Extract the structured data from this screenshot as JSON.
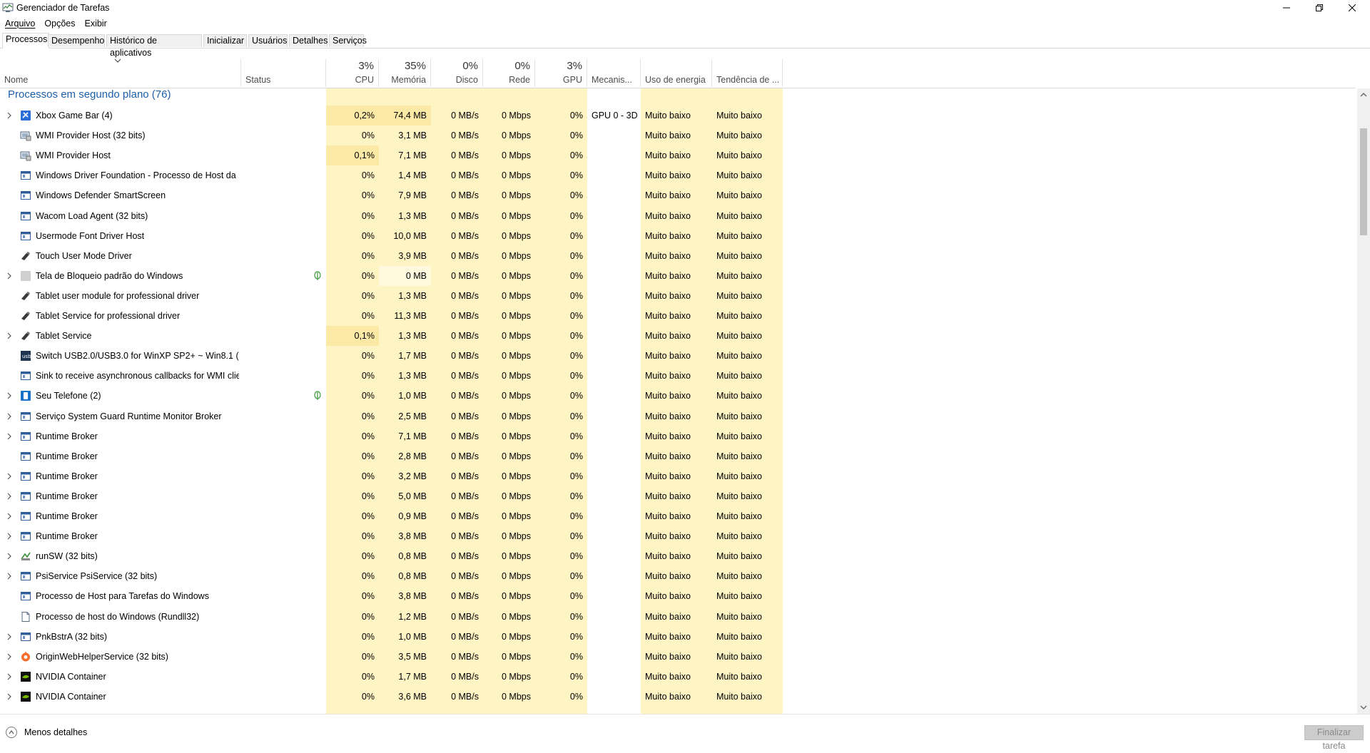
{
  "window": {
    "title": "Gerenciador de Tarefas"
  },
  "menu": {
    "items": [
      "Arquivo",
      "Opções",
      "Exibir"
    ]
  },
  "tabs": [
    {
      "label": "Processos",
      "active": true
    },
    {
      "label": "Desempenho",
      "active": false
    },
    {
      "label": "Histórico de aplicativos",
      "active": false
    },
    {
      "label": "Inicializar",
      "active": false
    },
    {
      "label": "Usuários",
      "active": false
    },
    {
      "label": "Detalhes",
      "active": false
    },
    {
      "label": "Serviços",
      "active": false
    }
  ],
  "columns": {
    "name": {
      "label": "Nome"
    },
    "status": {
      "label": "Status"
    },
    "cpu": {
      "label": "CPU",
      "pct": "3%"
    },
    "memory": {
      "label": "Memória",
      "pct": "35%"
    },
    "disk": {
      "label": "Disco",
      "pct": "0%"
    },
    "network": {
      "label": "Rede",
      "pct": "0%"
    },
    "gpu": {
      "label": "GPU",
      "pct": "3%"
    },
    "gpu_engine": {
      "label": "Mecanis..."
    },
    "power": {
      "label": "Uso de energia"
    },
    "power_trend": {
      "label": "Tendência de ..."
    }
  },
  "group": {
    "title": "Processos em segundo plano (76)"
  },
  "colors": {
    "heat_light": "#fff4c4",
    "heat_medium": "#fde9a6",
    "group_title": "#1e5fa8",
    "suspended_leaf": "#3c9a3c"
  },
  "processes": [
    {
      "name": "Xbox Game Bar (4)",
      "icon": "xbox-game-bar-icon",
      "expand": true,
      "leaf": false,
      "cpu": "0,2%",
      "mem": "74,4 MB",
      "disk": "0 MB/s",
      "net": "0 Mbps",
      "gpu": "0%",
      "engine": "GPU 0 - 3D",
      "power": "Muito baixo",
      "trend": "Muito baixo",
      "cpu_hot": true,
      "mem_hot": true
    },
    {
      "name": "WMI Provider Host (32 bits)",
      "icon": "wmi-host-icon",
      "expand": false,
      "leaf": false,
      "cpu": "0%",
      "mem": "3,1 MB",
      "disk": "0 MB/s",
      "net": "0 Mbps",
      "gpu": "0%",
      "engine": "",
      "power": "Muito baixo",
      "trend": "Muito baixo",
      "cpu_hot": false,
      "mem_hot": false
    },
    {
      "name": "WMI Provider Host",
      "icon": "wmi-host-icon",
      "expand": false,
      "leaf": false,
      "cpu": "0,1%",
      "mem": "7,1 MB",
      "disk": "0 MB/s",
      "net": "0 Mbps",
      "gpu": "0%",
      "engine": "",
      "power": "Muito baixo",
      "trend": "Muito baixo",
      "cpu_hot": true,
      "mem_hot": false
    },
    {
      "name": "Windows Driver Foundation - Processo de Host da ...",
      "icon": "window-app-icon",
      "expand": false,
      "leaf": false,
      "cpu": "0%",
      "mem": "1,4 MB",
      "disk": "0 MB/s",
      "net": "0 Mbps",
      "gpu": "0%",
      "engine": "",
      "power": "Muito baixo",
      "trend": "Muito baixo",
      "cpu_hot": false,
      "mem_hot": false
    },
    {
      "name": "Windows Defender SmartScreen",
      "icon": "window-app-icon",
      "expand": false,
      "leaf": false,
      "cpu": "0%",
      "mem": "7,9 MB",
      "disk": "0 MB/s",
      "net": "0 Mbps",
      "gpu": "0%",
      "engine": "",
      "power": "Muito baixo",
      "trend": "Muito baixo",
      "cpu_hot": false,
      "mem_hot": false
    },
    {
      "name": "Wacom Load Agent (32 bits)",
      "icon": "window-app-icon",
      "expand": false,
      "leaf": false,
      "cpu": "0%",
      "mem": "1,3 MB",
      "disk": "0 MB/s",
      "net": "0 Mbps",
      "gpu": "0%",
      "engine": "",
      "power": "Muito baixo",
      "trend": "Muito baixo",
      "cpu_hot": false,
      "mem_hot": false
    },
    {
      "name": "Usermode Font Driver Host",
      "icon": "window-app-icon",
      "expand": false,
      "leaf": false,
      "cpu": "0%",
      "mem": "10,0 MB",
      "disk": "0 MB/s",
      "net": "0 Mbps",
      "gpu": "0%",
      "engine": "",
      "power": "Muito baixo",
      "trend": "Muito baixo",
      "cpu_hot": false,
      "mem_hot": false
    },
    {
      "name": "Touch User Mode Driver",
      "icon": "pen-tablet-icon",
      "expand": false,
      "leaf": false,
      "cpu": "0%",
      "mem": "3,9 MB",
      "disk": "0 MB/s",
      "net": "0 Mbps",
      "gpu": "0%",
      "engine": "",
      "power": "Muito baixo",
      "trend": "Muito baixo",
      "cpu_hot": false,
      "mem_hot": false
    },
    {
      "name": "Tela de Bloqueio padrão do Windows",
      "icon": "lockscreen-icon",
      "expand": true,
      "leaf": true,
      "cpu": "0%",
      "mem": "0 MB",
      "disk": "0 MB/s",
      "net": "0 Mbps",
      "gpu": "0%",
      "engine": "",
      "power": "Muito baixo",
      "trend": "Muito baixo",
      "cpu_hot": false,
      "mem_hot": false,
      "mem_cold": true
    },
    {
      "name": "Tablet user module for professional driver",
      "icon": "pen-tablet-icon",
      "expand": false,
      "leaf": false,
      "cpu": "0%",
      "mem": "1,3 MB",
      "disk": "0 MB/s",
      "net": "0 Mbps",
      "gpu": "0%",
      "engine": "",
      "power": "Muito baixo",
      "trend": "Muito baixo",
      "cpu_hot": false,
      "mem_hot": false
    },
    {
      "name": "Tablet Service for professional driver",
      "icon": "pen-tablet-icon",
      "expand": false,
      "leaf": false,
      "cpu": "0%",
      "mem": "11,3 MB",
      "disk": "0 MB/s",
      "net": "0 Mbps",
      "gpu": "0%",
      "engine": "",
      "power": "Muito baixo",
      "trend": "Muito baixo",
      "cpu_hot": false,
      "mem_hot": false
    },
    {
      "name": "Tablet Service",
      "icon": "pen-tablet-icon",
      "expand": true,
      "leaf": false,
      "cpu": "0,1%",
      "mem": "1,3 MB",
      "disk": "0 MB/s",
      "net": "0 Mbps",
      "gpu": "0%",
      "engine": "",
      "power": "Muito baixo",
      "trend": "Muito baixo",
      "cpu_hot": true,
      "mem_hot": false
    },
    {
      "name": "Switch USB2.0/USB3.0 for WinXP SP2+ ~ Win8.1 (32...",
      "icon": "usb-switch-icon",
      "expand": false,
      "leaf": false,
      "cpu": "0%",
      "mem": "1,7 MB",
      "disk": "0 MB/s",
      "net": "0 Mbps",
      "gpu": "0%",
      "engine": "",
      "power": "Muito baixo",
      "trend": "Muito baixo",
      "cpu_hot": false,
      "mem_hot": false
    },
    {
      "name": "Sink to receive asynchronous callbacks for WMI clie...",
      "icon": "window-app-icon",
      "expand": false,
      "leaf": false,
      "cpu": "0%",
      "mem": "1,3 MB",
      "disk": "0 MB/s",
      "net": "0 Mbps",
      "gpu": "0%",
      "engine": "",
      "power": "Muito baixo",
      "trend": "Muito baixo",
      "cpu_hot": false,
      "mem_hot": false
    },
    {
      "name": "Seu Telefone (2)",
      "icon": "your-phone-icon",
      "expand": true,
      "leaf": true,
      "cpu": "0%",
      "mem": "1,0 MB",
      "disk": "0 MB/s",
      "net": "0 Mbps",
      "gpu": "0%",
      "engine": "",
      "power": "Muito baixo",
      "trend": "Muito baixo",
      "cpu_hot": false,
      "mem_hot": false
    },
    {
      "name": "Serviço System Guard Runtime Monitor Broker",
      "icon": "window-app-icon",
      "expand": true,
      "leaf": false,
      "cpu": "0%",
      "mem": "2,5 MB",
      "disk": "0 MB/s",
      "net": "0 Mbps",
      "gpu": "0%",
      "engine": "",
      "power": "Muito baixo",
      "trend": "Muito baixo",
      "cpu_hot": false,
      "mem_hot": false
    },
    {
      "name": "Runtime Broker",
      "icon": "window-app-icon",
      "expand": true,
      "leaf": false,
      "cpu": "0%",
      "mem": "7,1 MB",
      "disk": "0 MB/s",
      "net": "0 Mbps",
      "gpu": "0%",
      "engine": "",
      "power": "Muito baixo",
      "trend": "Muito baixo",
      "cpu_hot": false,
      "mem_hot": false
    },
    {
      "name": "Runtime Broker",
      "icon": "window-app-icon",
      "expand": false,
      "leaf": false,
      "cpu": "0%",
      "mem": "2,8 MB",
      "disk": "0 MB/s",
      "net": "0 Mbps",
      "gpu": "0%",
      "engine": "",
      "power": "Muito baixo",
      "trend": "Muito baixo",
      "cpu_hot": false,
      "mem_hot": false
    },
    {
      "name": "Runtime Broker",
      "icon": "window-app-icon",
      "expand": true,
      "leaf": false,
      "cpu": "0%",
      "mem": "3,2 MB",
      "disk": "0 MB/s",
      "net": "0 Mbps",
      "gpu": "0%",
      "engine": "",
      "power": "Muito baixo",
      "trend": "Muito baixo",
      "cpu_hot": false,
      "mem_hot": false
    },
    {
      "name": "Runtime Broker",
      "icon": "window-app-icon",
      "expand": true,
      "leaf": false,
      "cpu": "0%",
      "mem": "5,0 MB",
      "disk": "0 MB/s",
      "net": "0 Mbps",
      "gpu": "0%",
      "engine": "",
      "power": "Muito baixo",
      "trend": "Muito baixo",
      "cpu_hot": false,
      "mem_hot": false
    },
    {
      "name": "Runtime Broker",
      "icon": "window-app-icon",
      "expand": true,
      "leaf": false,
      "cpu": "0%",
      "mem": "0,9 MB",
      "disk": "0 MB/s",
      "net": "0 Mbps",
      "gpu": "0%",
      "engine": "",
      "power": "Muito baixo",
      "trend": "Muito baixo",
      "cpu_hot": false,
      "mem_hot": false
    },
    {
      "name": "Runtime Broker",
      "icon": "window-app-icon",
      "expand": true,
      "leaf": false,
      "cpu": "0%",
      "mem": "3,8 MB",
      "disk": "0 MB/s",
      "net": "0 Mbps",
      "gpu": "0%",
      "engine": "",
      "power": "Muito baixo",
      "trend": "Muito baixo",
      "cpu_hot": false,
      "mem_hot": false
    },
    {
      "name": "runSW (32 bits)",
      "icon": "runsw-icon",
      "expand": true,
      "leaf": false,
      "cpu": "0%",
      "mem": "0,8 MB",
      "disk": "0 MB/s",
      "net": "0 Mbps",
      "gpu": "0%",
      "engine": "",
      "power": "Muito baixo",
      "trend": "Muito baixo",
      "cpu_hot": false,
      "mem_hot": false
    },
    {
      "name": "PsiService PsiService (32 bits)",
      "icon": "window-app-icon",
      "expand": true,
      "leaf": false,
      "cpu": "0%",
      "mem": "0,8 MB",
      "disk": "0 MB/s",
      "net": "0 Mbps",
      "gpu": "0%",
      "engine": "",
      "power": "Muito baixo",
      "trend": "Muito baixo",
      "cpu_hot": false,
      "mem_hot": false
    },
    {
      "name": "Processo de Host para Tarefas do Windows",
      "icon": "window-app-icon",
      "expand": false,
      "leaf": false,
      "cpu": "0%",
      "mem": "3,8 MB",
      "disk": "0 MB/s",
      "net": "0 Mbps",
      "gpu": "0%",
      "engine": "",
      "power": "Muito baixo",
      "trend": "Muito baixo",
      "cpu_hot": false,
      "mem_hot": false
    },
    {
      "name": "Processo de host do Windows (Rundll32)",
      "icon": "document-icon",
      "expand": false,
      "leaf": false,
      "cpu": "0%",
      "mem": "1,2 MB",
      "disk": "0 MB/s",
      "net": "0 Mbps",
      "gpu": "0%",
      "engine": "",
      "power": "Muito baixo",
      "trend": "Muito baixo",
      "cpu_hot": false,
      "mem_hot": false
    },
    {
      "name": "PnkBstrA (32 bits)",
      "icon": "window-app-icon",
      "expand": true,
      "leaf": false,
      "cpu": "0%",
      "mem": "1,0 MB",
      "disk": "0 MB/s",
      "net": "0 Mbps",
      "gpu": "0%",
      "engine": "",
      "power": "Muito baixo",
      "trend": "Muito baixo",
      "cpu_hot": false,
      "mem_hot": false
    },
    {
      "name": "OriginWebHelperService (32 bits)",
      "icon": "origin-icon",
      "expand": true,
      "leaf": false,
      "cpu": "0%",
      "mem": "3,5 MB",
      "disk": "0 MB/s",
      "net": "0 Mbps",
      "gpu": "0%",
      "engine": "",
      "power": "Muito baixo",
      "trend": "Muito baixo",
      "cpu_hot": false,
      "mem_hot": false
    },
    {
      "name": "NVIDIA Container",
      "icon": "nvidia-icon",
      "expand": true,
      "leaf": false,
      "cpu": "0%",
      "mem": "1,7 MB",
      "disk": "0 MB/s",
      "net": "0 Mbps",
      "gpu": "0%",
      "engine": "",
      "power": "Muito baixo",
      "trend": "Muito baixo",
      "cpu_hot": false,
      "mem_hot": false
    },
    {
      "name": "NVIDIA Container",
      "icon": "nvidia-icon",
      "expand": true,
      "leaf": false,
      "cpu": "0%",
      "mem": "3,6 MB",
      "disk": "0 MB/s",
      "net": "0 Mbps",
      "gpu": "0%",
      "engine": "",
      "power": "Muito baixo",
      "trend": "Muito baixo",
      "cpu_hot": false,
      "mem_hot": false
    }
  ],
  "footer": {
    "less_details": "Menos detalhes",
    "end_task": "Finalizar tarefa"
  }
}
